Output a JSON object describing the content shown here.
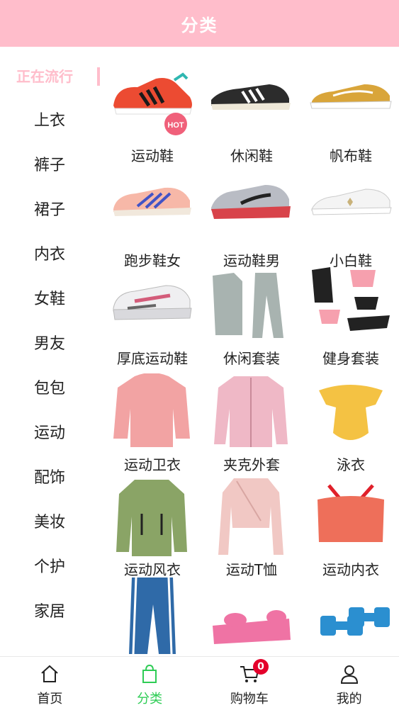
{
  "header": {
    "title": "分类"
  },
  "sidebar": {
    "items": [
      {
        "label": "正在流行",
        "active": true
      },
      {
        "label": "上衣"
      },
      {
        "label": "裤子"
      },
      {
        "label": "裙子"
      },
      {
        "label": "内衣"
      },
      {
        "label": "女鞋"
      },
      {
        "label": "男友"
      },
      {
        "label": "包包"
      },
      {
        "label": "运动"
      },
      {
        "label": "配饰"
      },
      {
        "label": "美妆"
      },
      {
        "label": "个护"
      },
      {
        "label": "家居"
      }
    ]
  },
  "products": [
    {
      "label": "运动鞋",
      "icon": "red-sneaker-image",
      "badge": "HOT"
    },
    {
      "label": "休闲鞋",
      "icon": "black-casual-shoe-image"
    },
    {
      "label": "帆布鞋",
      "icon": "yellow-canvas-shoe-image"
    },
    {
      "label": "跑步鞋女",
      "icon": "pink-running-shoe-image"
    },
    {
      "label": "运动鞋男",
      "icon": "grey-mens-sneaker-image"
    },
    {
      "label": "小白鞋",
      "icon": "white-shoe-image"
    },
    {
      "label": "厚底运动鞋",
      "icon": "chunky-sneaker-image"
    },
    {
      "label": "休闲套装",
      "icon": "grey-tracksuit-image"
    },
    {
      "label": "健身套装",
      "icon": "fitness-set-image"
    },
    {
      "label": "运动卫衣",
      "icon": "pink-hoodie-image"
    },
    {
      "label": "夹克外套",
      "icon": "pink-jacket-image"
    },
    {
      "label": "泳衣",
      "icon": "yellow-swimsuit-image"
    },
    {
      "label": "运动风衣",
      "icon": "green-windbreaker-image"
    },
    {
      "label": "运动T恤",
      "icon": "pink-wrap-top-image"
    },
    {
      "label": "运动内衣",
      "icon": "sports-bra-image"
    },
    {
      "label": "",
      "icon": "blue-track-pants-image"
    },
    {
      "label": "",
      "icon": "pink-yoga-mat-image"
    },
    {
      "label": "",
      "icon": "blue-dumbbells-image"
    }
  ],
  "tabbar": {
    "tabs": [
      {
        "label": "首页",
        "icon": "home-icon"
      },
      {
        "label": "分类",
        "icon": "shopping-bag-icon",
        "active": true
      },
      {
        "label": "购物车",
        "icon": "cart-icon",
        "badge": "0"
      },
      {
        "label": "我的",
        "icon": "user-icon"
      }
    ]
  },
  "colors": {
    "accent": "#ffbdcb",
    "active_tab": "#2ecc55",
    "badge": "#e4002b"
  }
}
